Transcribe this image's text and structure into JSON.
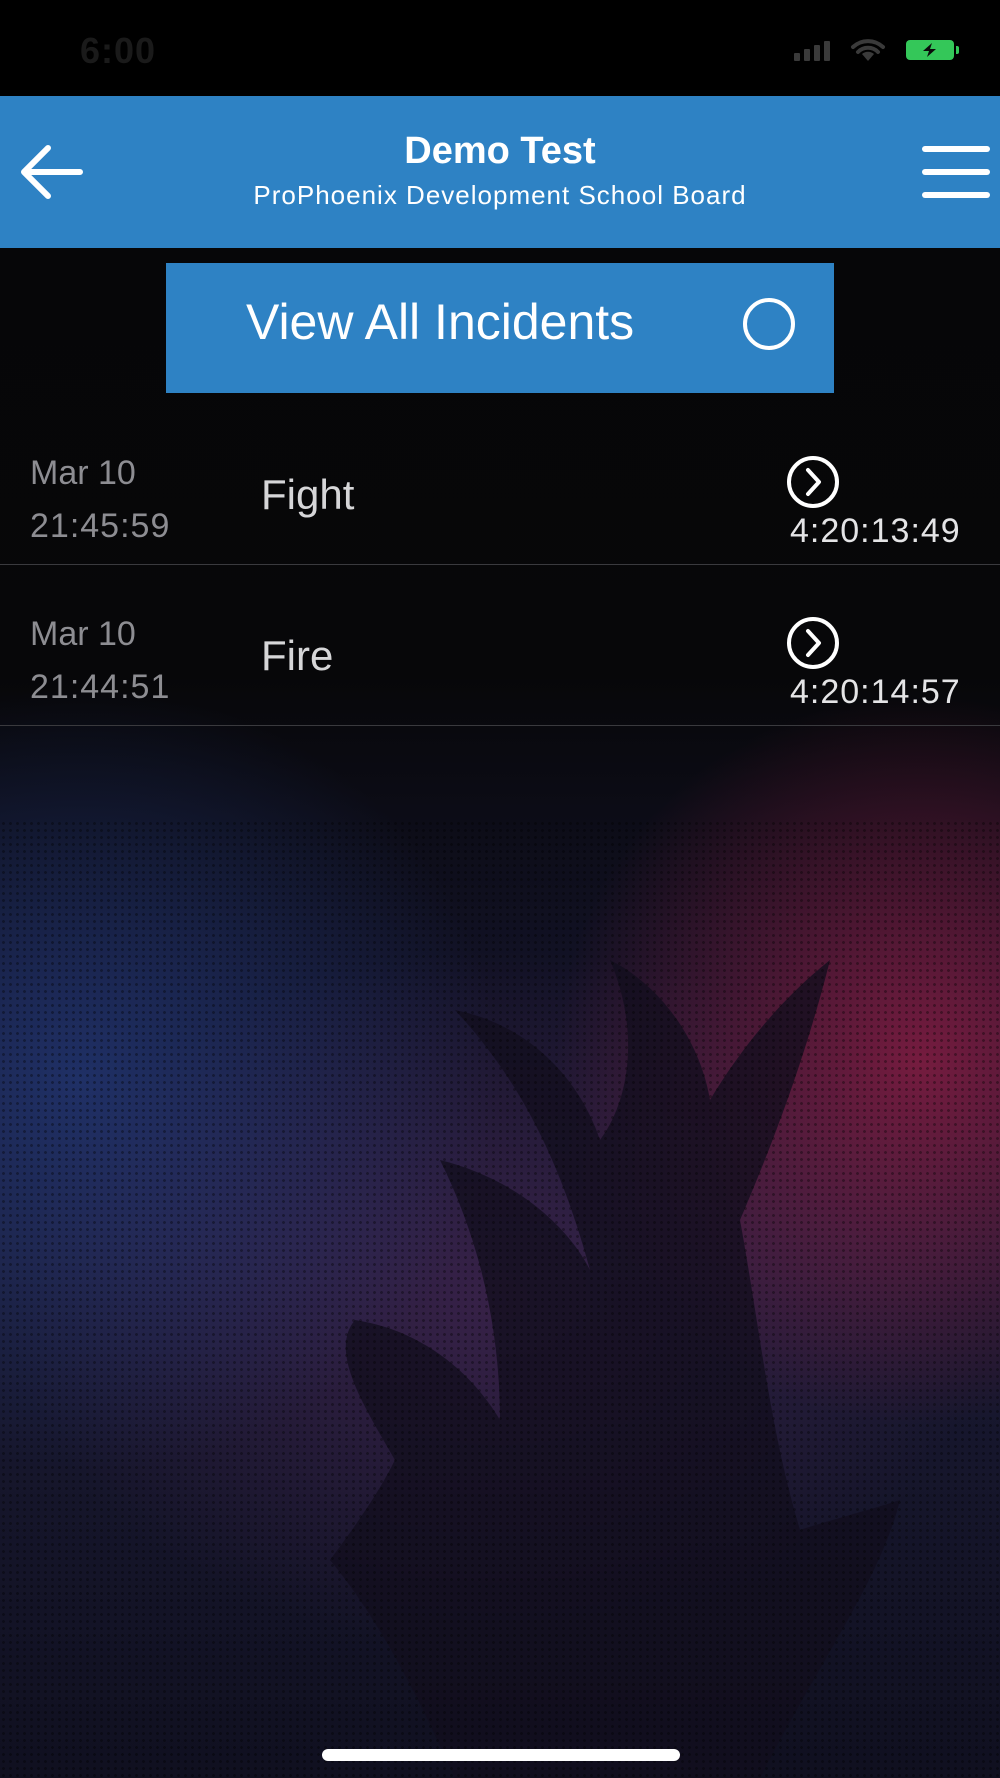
{
  "status_bar": {
    "time": "6:00",
    "icons": [
      "signal-icon",
      "wifi-icon",
      "battery-charging-icon"
    ],
    "battery_color": "#34c759"
  },
  "header": {
    "title": "Demo Test",
    "subtitle": "ProPhoenix Development School Board",
    "back_icon": "arrow-left-icon",
    "menu_icon": "hamburger-menu-icon",
    "background_color": "#2e82c4"
  },
  "view_all": {
    "label": "View All Incidents",
    "icon": "radio-circle-icon",
    "background_color": "#2e82c4"
  },
  "incidents": [
    {
      "date": "Mar 10",
      "time": "21:45:59",
      "type": "Fight",
      "elapsed": "4:20:13:49",
      "icon": "chevron-right-circle-icon"
    },
    {
      "date": "Mar 10",
      "time": "21:44:51",
      "type": "Fire",
      "elapsed": "4:20:14:57",
      "icon": "chevron-right-circle-icon"
    }
  ],
  "background": {
    "art": "phoenix-flame-logo",
    "colors": [
      "#060607",
      "#2a3f8a",
      "#8c1e46"
    ]
  }
}
